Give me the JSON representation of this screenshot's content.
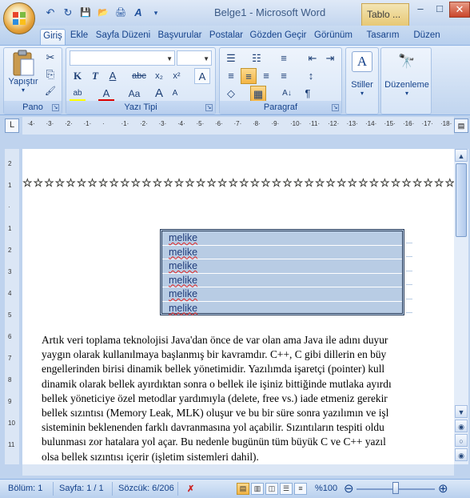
{
  "window": {
    "title": "Belge1 - Microsoft Word",
    "context_tab": "Tablo ...",
    "minimize": "–",
    "restore": "□",
    "close": "✕"
  },
  "qat": {
    "undo": "↶",
    "redo": "↻",
    "save": "💾",
    "open": "📂",
    "print": "🖨",
    "format": "A",
    "more": "▾"
  },
  "tabs": [
    {
      "label": "Giriş"
    },
    {
      "label": "Ekle"
    },
    {
      "label": "Sayfa Düzeni"
    },
    {
      "label": "Başvurular"
    },
    {
      "label": "Postalar"
    },
    {
      "label": "Gözden Geçir"
    },
    {
      "label": "Görünüm"
    },
    {
      "label": "Tasarım"
    },
    {
      "label": "Düzen"
    }
  ],
  "help": "?",
  "ribbon": {
    "pano": {
      "label": "Pano",
      "paste": "Yapıştır",
      "cut": "✂",
      "copy": "⎘",
      "painter": "🖌"
    },
    "yazi_tipi": {
      "label": "Yazı Tipi",
      "font_name": "",
      "font_size": "",
      "bold": "K",
      "italic": "T",
      "underline": "A",
      "strike": "abc",
      "sub": "x₂",
      "sup": "x²",
      "clear": "A",
      "highlight": "ab",
      "color": "A",
      "case": "Aa",
      "grow": "A",
      "shrink": "A"
    },
    "paragraf": {
      "label": "Paragraf",
      "bullets": "☰",
      "numbering": "☷",
      "multilevel": "≡",
      "decrease_indent": "⇤",
      "increase_indent": "⇥",
      "align_left": "≡",
      "center": "≡",
      "align_right": "≡",
      "justify": "≡",
      "line_spacing": "↕",
      "shading": "◇",
      "borders": "▦",
      "sort": "A↓",
      "pilcrow": "¶"
    },
    "stiller": {
      "label": "Stiller",
      "icon": "A"
    },
    "duzenleme": {
      "label": "Düzenleme",
      "icon": "🔭"
    }
  },
  "ruler": {
    "corner": "L",
    "top_marks": [
      "·4·",
      "·3·",
      "·2·",
      "·1·",
      "·",
      "·1·",
      "·2·",
      "·3·",
      "·4·",
      "·5·",
      "·6·",
      "·7·",
      "·8·",
      "·9·",
      "·10·",
      "·11·",
      "·12·",
      "·13·",
      "·14·",
      "·15·",
      "·16·",
      "·17·",
      "·18·"
    ],
    "left_marks": [
      "2",
      "1",
      "·",
      "1",
      "2",
      "3",
      "4",
      "5",
      "6",
      "7",
      "8",
      "9",
      "10",
      "11"
    ]
  },
  "document": {
    "stars": "☆☆☆☆☆☆☆☆☆☆☆☆☆☆☆☆☆☆☆☆☆☆☆☆☆☆☆☆☆☆☆☆☆☆☆☆☆☆☆☆",
    "table_rows": [
      "melike",
      "melike",
      "melike",
      "melike",
      "melike",
      "melike"
    ],
    "paragraph_lines": [
      "Artık veri toplama teknolojisi Java'dan önce de var olan ama Java ile adını duyur",
      "yaygın olarak kullanılmaya başlanmış bir kavramdır. C++, C gibi dillerin en büy",
      "engellerinden birisi dinamik bellek yönetimidir. Yazılımda işaretçi (pointer) kull",
      "dinamik olarak bellek ayırdıktan sonra o bellek ile işiniz bittiğinde mutlaka ayırdı",
      "bellek yöneticiye özel metodlar yardımıyla (delete, free vs.) iade etmeniz gerekir",
      "bellek sızıntısı (Memory Leak, MLK) oluşur ve bu bir süre sonra yazılımın ve işl",
      "sisteminin beklenenden farklı davranmasına yol açabilir. Sızıntıların tespiti oldu",
      "bulunması zor hatalara yol açar. Bu nedenle bugünün tüm büyük C ve C++ yazıl",
      "olsa bellek sızıntısı içerir (işletim sistemleri dahil)."
    ]
  },
  "scrollbar": {
    "up": "▲",
    "down": "▼",
    "prev": "◉",
    "select": "○",
    "next": "◉"
  },
  "status": {
    "section": "Bölüm: 1",
    "page": "Sayfa: 1 / 1",
    "words": "Sözcük: 6/206",
    "proof": "✗",
    "zoom": "%100",
    "zoom_out": "⊖",
    "zoom_in": "⊕",
    "zoom_level": 0.5
  }
}
